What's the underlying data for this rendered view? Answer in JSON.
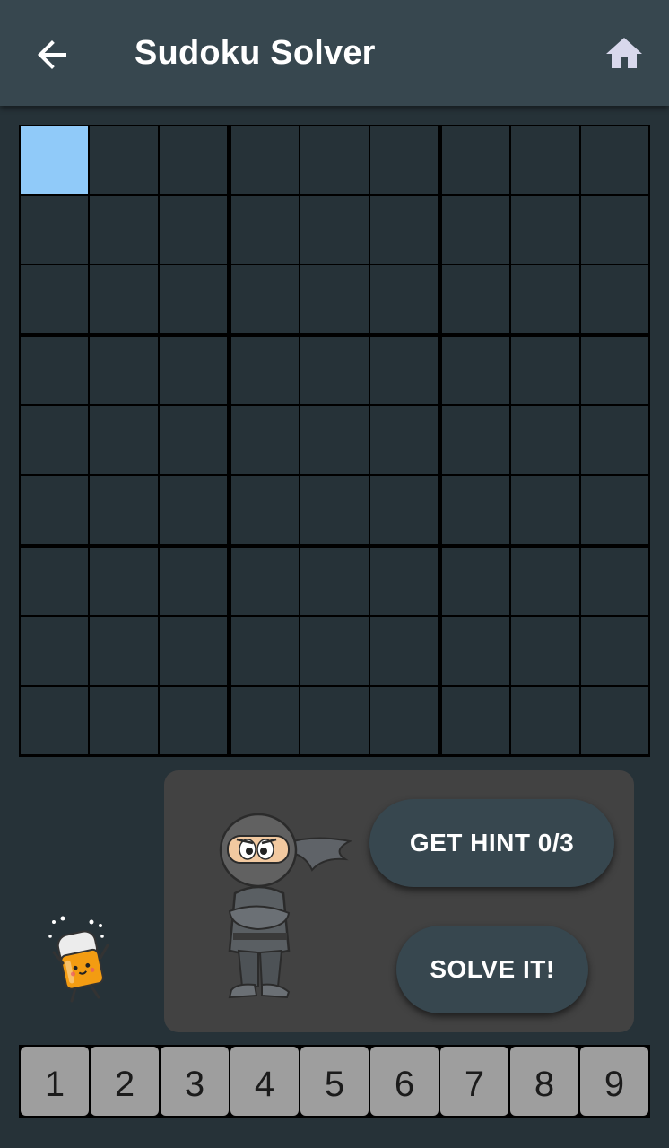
{
  "app": {
    "title": "Sudoku Solver",
    "back_icon": "arrow-back-icon",
    "home_icon": "home-icon"
  },
  "board": {
    "size": 9,
    "selected_cell": {
      "row": 0,
      "col": 0
    },
    "cells": [
      [
        "",
        "",
        "",
        "",
        "",
        "",
        "",
        "",
        ""
      ],
      [
        "",
        "",
        "",
        "",
        "",
        "",
        "",
        "",
        ""
      ],
      [
        "",
        "",
        "",
        "",
        "",
        "",
        "",
        "",
        ""
      ],
      [
        "",
        "",
        "",
        "",
        "",
        "",
        "",
        "",
        ""
      ],
      [
        "",
        "",
        "",
        "",
        "",
        "",
        "",
        "",
        ""
      ],
      [
        "",
        "",
        "",
        "",
        "",
        "",
        "",
        "",
        ""
      ],
      [
        "",
        "",
        "",
        "",
        "",
        "",
        "",
        "",
        ""
      ],
      [
        "",
        "",
        "",
        "",
        "",
        "",
        "",
        "",
        ""
      ],
      [
        "",
        "",
        "",
        "",
        "",
        "",
        "",
        "",
        ""
      ]
    ]
  },
  "actions": {
    "hint_label": "GET HINT 0/3",
    "solve_label": "SOLVE IT!",
    "illustration": "ninja-illustration",
    "eraser": "eraser-icon"
  },
  "numpad": {
    "keys": [
      "1",
      "2",
      "3",
      "4",
      "5",
      "6",
      "7",
      "8",
      "9"
    ]
  },
  "colors": {
    "background": "#263238",
    "appbar": "#37474f",
    "selected_cell": "#90caf9",
    "panel": "#424242",
    "numkey": "#9e9e9e"
  }
}
